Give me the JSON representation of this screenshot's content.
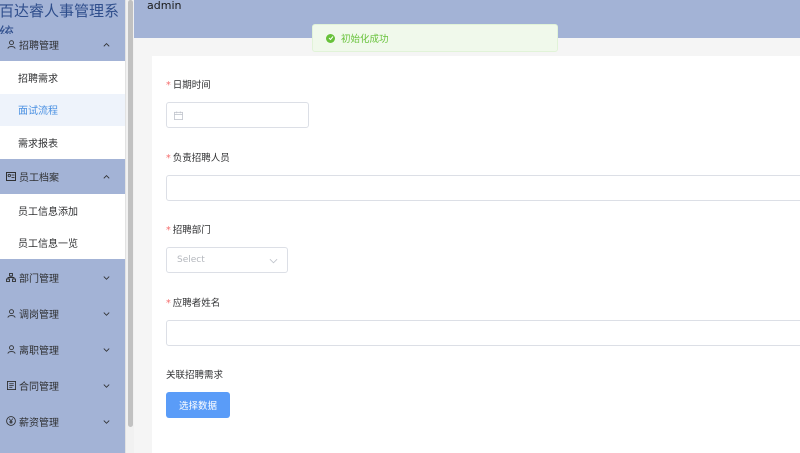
{
  "app": {
    "title": "百达睿人事管理系统"
  },
  "header": {
    "username": "admin"
  },
  "toast": {
    "message": "初始化成功"
  },
  "sidebar": {
    "groups": [
      {
        "label": "招聘管理",
        "icon": "user-icon",
        "items": [
          "招聘需求",
          "面试流程",
          "需求报表"
        ],
        "active_item": "面试流程"
      },
      {
        "label": "员工档案",
        "icon": "id-card-icon",
        "items": [
          "员工信息添加",
          "员工信息一览"
        ]
      },
      {
        "label": "部门管理",
        "icon": "org-chart-icon"
      },
      {
        "label": "调岗管理",
        "icon": "user-icon"
      },
      {
        "label": "离职管理",
        "icon": "user-icon"
      },
      {
        "label": "合同管理",
        "icon": "document-icon"
      },
      {
        "label": "薪资管理",
        "icon": "yen-icon"
      }
    ]
  },
  "form": {
    "date_label": "日期时间",
    "recruiter_label": "负责招聘人员",
    "department_label": "招聘部门",
    "department_placeholder": "Select",
    "applicant_label": "应聘者姓名",
    "related_label": "关联招聘需求",
    "select_data_button": "选择数据"
  },
  "colors": {
    "sidebar_bg": "#a3b3d6",
    "accent": "#4a90e2",
    "required": "#f56c6c",
    "success": "#67c23a",
    "button": "#5a9cf8"
  }
}
